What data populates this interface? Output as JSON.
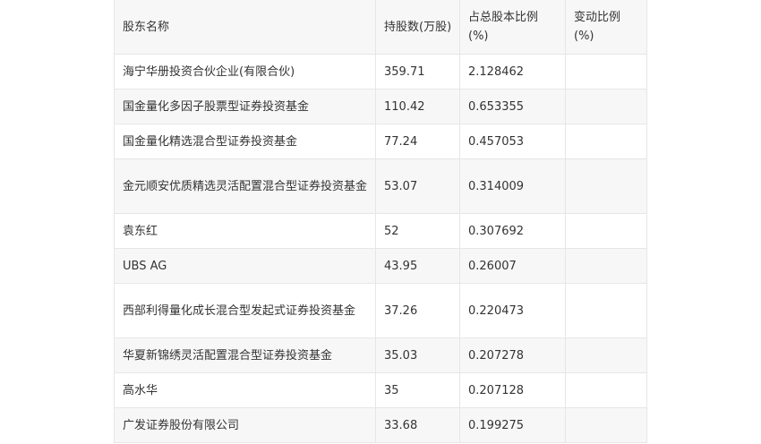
{
  "table": {
    "headers": [
      "股东名称",
      "持股数(万股)",
      "占总股本比例(%)",
      "变动比例(%)"
    ],
    "rows": [
      {
        "name": "海宁华册投资合伙企业(有限合伙)",
        "shares": "359.71",
        "ratio": "2.128462",
        "change": ""
      },
      {
        "name": "国金量化多因子股票型证券投资基金",
        "shares": "110.42",
        "ratio": "0.653355",
        "change": ""
      },
      {
        "name": "国金量化精选混合型证券投资基金",
        "shares": "77.24",
        "ratio": "0.457053",
        "change": ""
      },
      {
        "name": "金元顺安优质精选灵活配置混合型证券投资基金",
        "shares": "53.07",
        "ratio": "0.314009",
        "change": ""
      },
      {
        "name": "袁东红",
        "shares": "52",
        "ratio": "0.307692",
        "change": ""
      },
      {
        "name": "UBS AG",
        "shares": "43.95",
        "ratio": "0.26007",
        "change": ""
      },
      {
        "name": "西部利得量化成长混合型发起式证券投资基金",
        "shares": "37.26",
        "ratio": "0.220473",
        "change": ""
      },
      {
        "name": "华夏新锦绣灵活配置混合型证券投资基金",
        "shares": "35.03",
        "ratio": "0.207278",
        "change": ""
      },
      {
        "name": "高水华",
        "shares": "35",
        "ratio": "0.207128",
        "change": ""
      },
      {
        "name": "广发证券股份有限公司",
        "shares": "33.68",
        "ratio": "0.199275",
        "change": ""
      }
    ]
  }
}
